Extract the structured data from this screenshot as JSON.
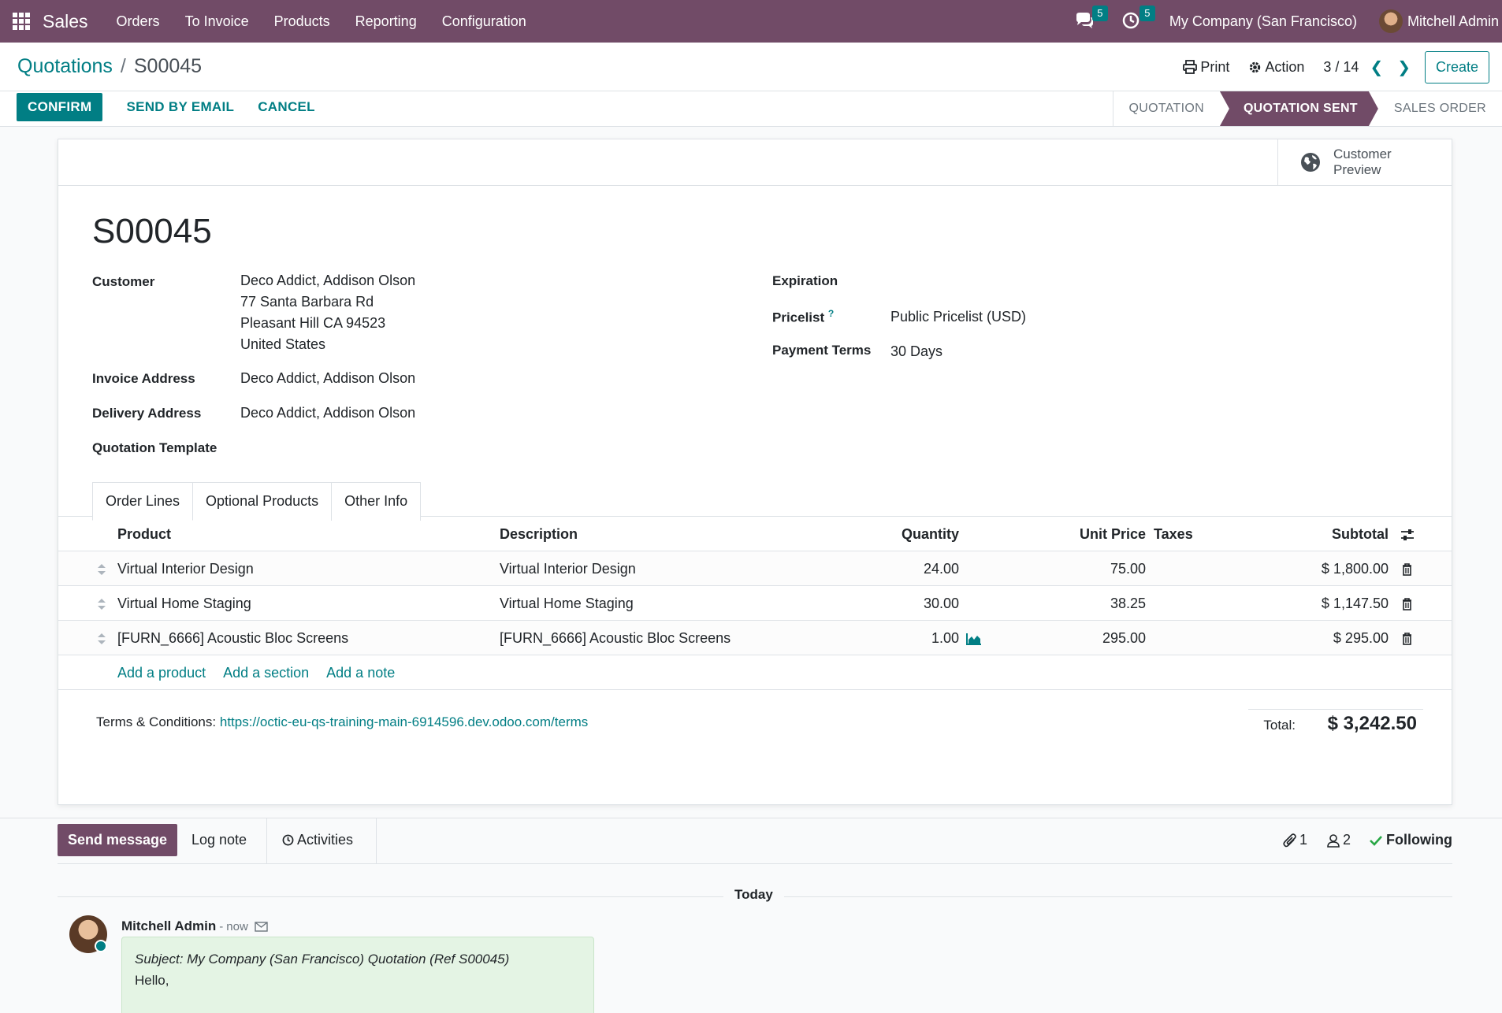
{
  "navbar": {
    "app_name": "Sales",
    "menu": [
      "Orders",
      "To Invoice",
      "Products",
      "Reporting",
      "Configuration"
    ],
    "messages_count": "5",
    "activities_count": "5",
    "company": "My Company (San Francisco)",
    "user": "Mitchell Admin"
  },
  "breadcrumb": {
    "parent": "Quotations",
    "separator": "/",
    "current": "S00045"
  },
  "control": {
    "print_label": "Print",
    "action_label": "Action",
    "pager": "3 / 14",
    "create_label": "Create"
  },
  "buttons": {
    "confirm": "CONFIRM",
    "send_email": "SEND BY EMAIL",
    "cancel": "CANCEL"
  },
  "statusbar": {
    "stages": [
      "QUOTATION",
      "QUOTATION SENT",
      "SALES ORDER"
    ],
    "active": "QUOTATION SENT"
  },
  "sheet": {
    "preview_label": "Customer Preview",
    "name": "S00045",
    "fields": {
      "customer_label": "Customer",
      "customer_lines": [
        "Deco Addict, Addison Olson",
        "77 Santa Barbara Rd",
        "Pleasant Hill CA 94523",
        "United States"
      ],
      "invoice_label": "Invoice Address",
      "invoice_value": "Deco Addict, Addison Olson",
      "delivery_label": "Delivery Address",
      "delivery_value": "Deco Addict, Addison Olson",
      "template_label": "Quotation Template",
      "expiration_label": "Expiration",
      "pricelist_label": "Pricelist",
      "pricelist_help": "?",
      "pricelist_value": "Public Pricelist (USD)",
      "payment_label": "Payment Terms",
      "payment_value": "30 Days"
    },
    "tabs": [
      "Order Lines",
      "Optional Products",
      "Other Info"
    ],
    "table": {
      "headers": {
        "product": "Product",
        "description": "Description",
        "quantity": "Quantity",
        "unit_price": "Unit Price",
        "taxes": "Taxes",
        "subtotal": "Subtotal"
      },
      "rows": [
        {
          "product": "Virtual Interior Design",
          "description": "Virtual Interior Design",
          "quantity": "24.00",
          "unit_price": "75.00",
          "taxes": "",
          "subtotal": "$ 1,800.00"
        },
        {
          "product": "Virtual Home Staging",
          "description": "Virtual Home Staging",
          "quantity": "30.00",
          "unit_price": "38.25",
          "taxes": "",
          "subtotal": "$ 1,147.50"
        },
        {
          "product": "[FURN_6666] Acoustic Bloc Screens",
          "description": "[FURN_6666] Acoustic Bloc Screens",
          "quantity": "1.00",
          "unit_price": "295.00",
          "taxes": "",
          "subtotal": "$ 295.00"
        }
      ],
      "add_links": [
        "Add a product",
        "Add a section",
        "Add a note"
      ]
    },
    "terms_label": "Terms & Conditions:",
    "terms_url": "https://octic-eu-qs-training-main-6914596.dev.odoo.com/terms",
    "total_label": "Total:",
    "total_value": "$ 3,242.50"
  },
  "chatter": {
    "send_message": "Send message",
    "log_note": "Log note",
    "activities": "Activities",
    "attachments_count": "1",
    "followers_count": "2",
    "following_label": "Following",
    "today_label": "Today",
    "message": {
      "author": "Mitchell Admin",
      "dash": "-",
      "time": "now",
      "subject": "Subject: My Company (San Francisco) Quotation (Ref S00045)",
      "body": "Hello,"
    }
  },
  "colors": {
    "brand": "#714b67",
    "accent": "#017e84",
    "success": "#28a745"
  }
}
